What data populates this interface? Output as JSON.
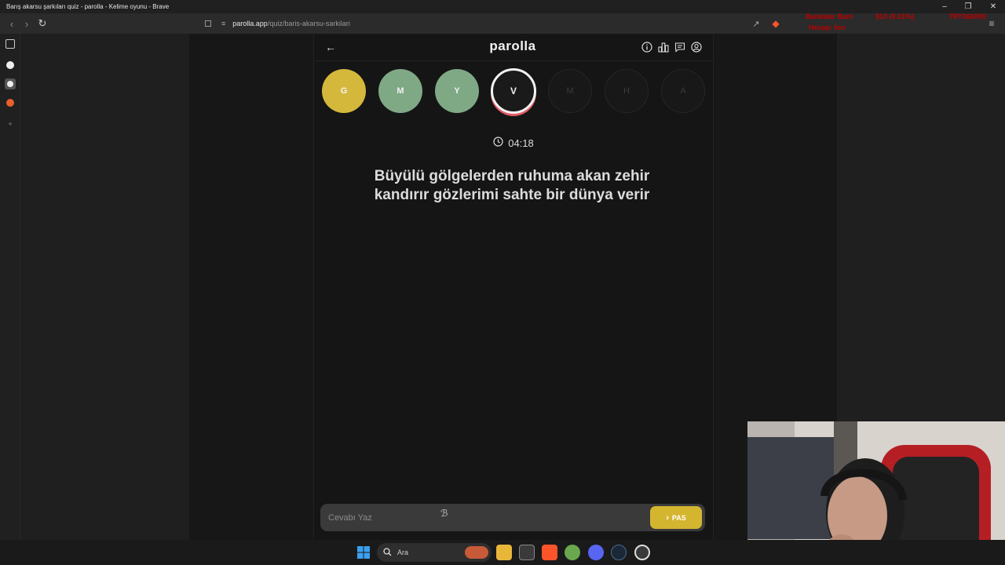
{
  "browser": {
    "window_title": "Barış akarsu şarkıları quiz - parolla - Kelime oyunu - Brave",
    "url_domain": "parolla.app",
    "url_path": "/quiz/baris-akarsu-sarkilari",
    "overlay_line1": "Bankalar Banl",
    "overlay_line1b": "$10 (0.01%)",
    "overlay_line1c": "TRY366000",
    "overlay_line2": "Hesap: fon"
  },
  "app": {
    "logo": "parolla",
    "letters": [
      {
        "letter": "G",
        "state": "passed",
        "color": "#d4b83c"
      },
      {
        "letter": "M",
        "state": "correct",
        "color": "#7fa985"
      },
      {
        "letter": "Y",
        "state": "correct",
        "color": "#7fa985"
      },
      {
        "letter": "V",
        "state": "active",
        "color": "#1a1a1a"
      },
      {
        "letter": "M",
        "state": "pending",
        "color": "#181818"
      },
      {
        "letter": "H",
        "state": "pending",
        "color": "#181818"
      },
      {
        "letter": "A",
        "state": "pending",
        "color": "#181818"
      }
    ],
    "timer": "04:18",
    "question_line1": "Büyülü gölgelerden ruhuma akan zehir",
    "question_line2": "kandırır gözlerimi sahte bir dünya verir",
    "answer_placeholder": "Cevabı Yaz",
    "pass_label": "PAS"
  },
  "taskbar": {
    "search_label": "Ara"
  },
  "colors": {
    "accent_yellow": "#d4b530",
    "correct_green": "#7fa985",
    "active_ring_red": "#e05a66"
  }
}
